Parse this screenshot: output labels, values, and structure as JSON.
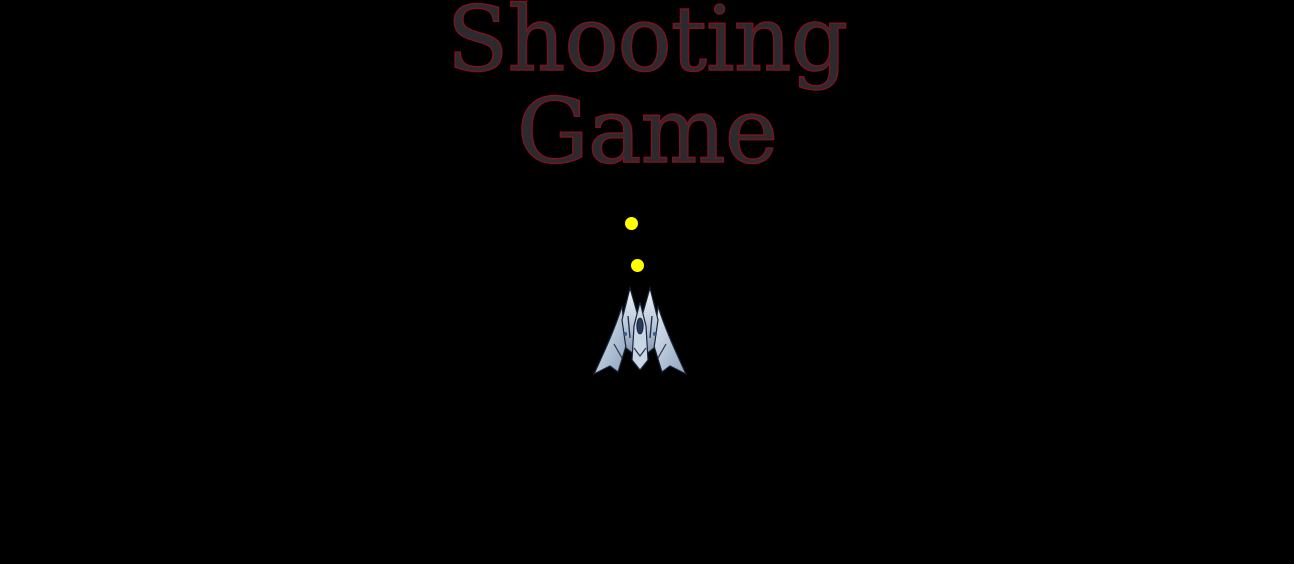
{
  "title": {
    "line1": "Shooting",
    "line2": "Game"
  },
  "colors": {
    "background": "#000000",
    "title_fill": "#2b2b2f",
    "title_outline": "#7a1420",
    "bullet": "#ffff00"
  },
  "sprites": {
    "player": "spaceship-icon",
    "projectile": "bullet-dot"
  },
  "bullets_on_screen": 2
}
